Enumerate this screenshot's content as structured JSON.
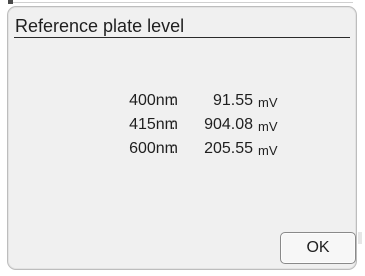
{
  "dialog": {
    "title": "Reference plate level",
    "readings": [
      {
        "wavelength": "400nm",
        "separator": ":",
        "value": "91.55",
        "unit": "mV"
      },
      {
        "wavelength": "415nm",
        "separator": ":",
        "value": "904.08",
        "unit": "mV"
      },
      {
        "wavelength": "600nm",
        "separator": ":",
        "value": "205.55",
        "unit": "mV"
      }
    ],
    "ok_label": "OK"
  },
  "colors": {
    "dialog_background": "#f0f0f0",
    "dialog_border": "#bdbdbd",
    "text": "#1f1f1f",
    "button_background": "#f7f7f7",
    "button_border": "#8a8a8a"
  }
}
